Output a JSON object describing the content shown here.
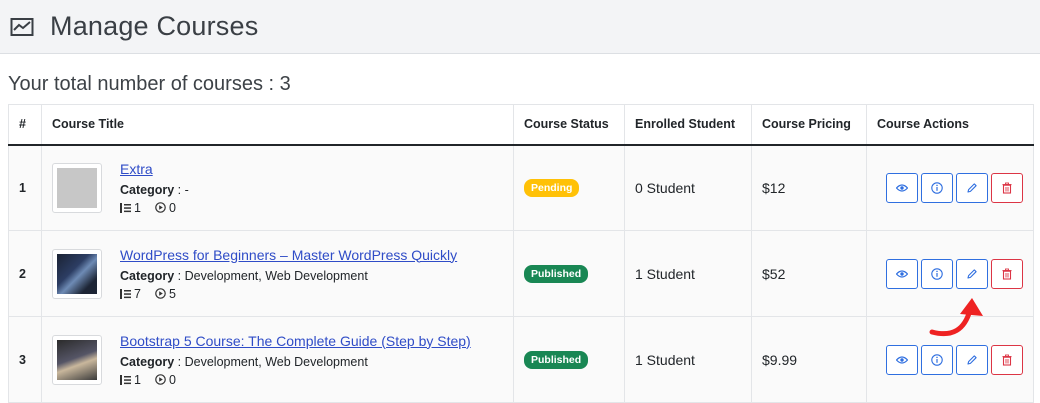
{
  "header": {
    "title": "Manage Courses",
    "icon": "chart-line-icon"
  },
  "summary": {
    "text": "Your total number of courses : 3"
  },
  "table": {
    "columns": [
      "#",
      "Course Title",
      "Course Status",
      "Enrolled Student",
      "Course Pricing",
      "Course Actions"
    ],
    "rows": [
      {
        "num": "1",
        "title": "Extra",
        "category_label": "Category",
        "category_value": " : -",
        "lessons": "1",
        "videos": "0",
        "status": "Pending",
        "enrolled": "0 Student",
        "price": "$12"
      },
      {
        "num": "2",
        "title": "WordPress for Beginners – Master WordPress Quickly",
        "category_label": "Category",
        "category_value": " : Development, Web Development",
        "lessons": "7",
        "videos": "5",
        "status": "Published",
        "enrolled": "1 Student",
        "price": "$52"
      },
      {
        "num": "3",
        "title": "Bootstrap 5 Course: The Complete Guide (Step by Step)",
        "category_label": "Category",
        "category_value": " : Development, Web Development",
        "lessons": "1",
        "videos": "0",
        "status": "Published",
        "enrolled": "1 Student",
        "price": "$9.99"
      }
    ]
  },
  "colors": {
    "link": "#2f4cc7",
    "primary": "#2f6fe0",
    "danger": "#dc3545",
    "pending": "#ffc107",
    "published": "#198754",
    "annotation": "#ee2222"
  }
}
